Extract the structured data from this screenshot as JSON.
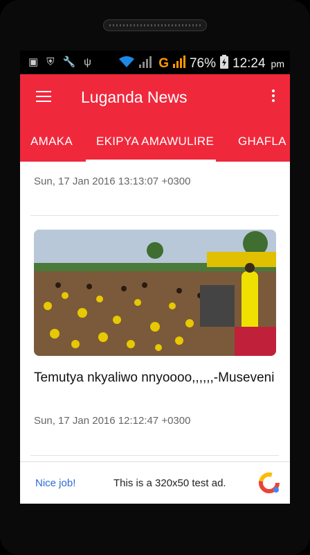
{
  "status_bar": {
    "battery_percent": "76%",
    "time": "12:24",
    "ampm": "pm",
    "carrier_icon": "G"
  },
  "app_bar": {
    "title": "Luganda News"
  },
  "tabs": [
    {
      "label": "AMAKA"
    },
    {
      "label": "EKIPYA AMAWULIRE"
    },
    {
      "label": "GHAFLA"
    }
  ],
  "articles": [
    {
      "date": "Sun, 17 Jan 2016 13:13:07 +0300"
    },
    {
      "headline": "Temutya nkyaliwo nnyoooo,,,,,,-Museveni",
      "date": "Sun, 17 Jan 2016 12:12:47 +0300",
      "image_alt": "rally"
    }
  ],
  "ad": {
    "nice_label": "Nice job!",
    "text": "This is a 320x50 test ad."
  },
  "colors": {
    "accent": "#f0283c",
    "link": "#2a6ad4"
  }
}
